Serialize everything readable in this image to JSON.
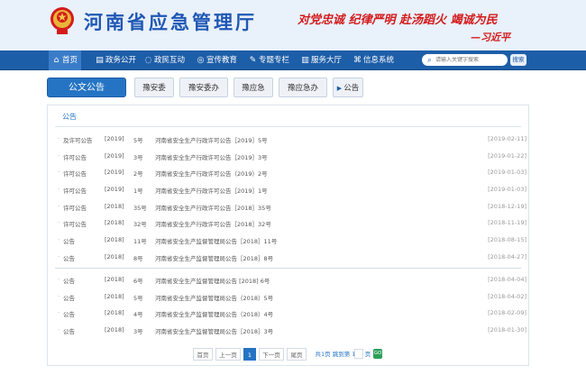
{
  "header": {
    "title": "河南省应急管理厅",
    "slogan": "对党忠诚  纪律严明  赴汤蹈火  竭诚为民",
    "signature": "—习近平"
  },
  "nav": {
    "items": [
      {
        "label": "首页",
        "icon": "home-icon"
      },
      {
        "label": "政务公开",
        "icon": "document-icon"
      },
      {
        "label": "政民互动",
        "icon": "chat-icon"
      },
      {
        "label": "宣传教育",
        "icon": "megaphone-icon"
      },
      {
        "label": "专题专栏",
        "icon": "pencil-icon"
      },
      {
        "label": "服务大厅",
        "icon": "building-icon"
      },
      {
        "label": "信息系统",
        "icon": "grid-icon"
      }
    ],
    "search_placeholder": "请输入关键字搜索",
    "search_button": "搜索"
  },
  "tabs": {
    "main": "公文公告",
    "items": [
      "豫安委",
      "豫安委办",
      "豫应急",
      "豫应急办"
    ],
    "current": "公告"
  },
  "panel": {
    "title": "公告",
    "rows": [
      {
        "category": "及许可公告",
        "year": "[2019]",
        "num": "5号",
        "title": "河南省安全生产行政许可公告［2019］5号",
        "date": "[2019-02-11]"
      },
      {
        "category": "许可公告",
        "year": "[2019]",
        "num": "3号",
        "title": "河南省安全生产行政许可公告［2019］3号",
        "date": "[2019-01-22]"
      },
      {
        "category": "许可公告",
        "year": "[2019]",
        "num": "2号",
        "title": "河南省安全生产行政许可公告（2019）2号",
        "date": "[2019-01-03]"
      },
      {
        "category": "许可公告",
        "year": "[2019]",
        "num": "1号",
        "title": "河南省安全生产行政许可公告［2019］1号",
        "date": "[2019-01-03]"
      },
      {
        "category": "许可公告",
        "year": "[2018]",
        "num": "35号",
        "title": "河南省安全生产行政许可公告［2018］35号",
        "date": "[2018-12-19]"
      },
      {
        "category": "许可公告",
        "year": "[2018]",
        "num": "32号",
        "title": "河南省安全生产行政许可公告［2018］32号",
        "date": "[2018-11-19]"
      },
      {
        "category": "公告",
        "year": "[2018]",
        "num": "11号",
        "title": "河南省安全生产监督管理局公告［2018］11号",
        "date": "[2018-08-15]"
      },
      {
        "category": "公告",
        "year": "[2018]",
        "num": "8号",
        "title": "河南省安全生产监督管理局公告［2018］8号",
        "date": "[2018-04-27]"
      },
      {
        "category": "公告",
        "year": "[2018]",
        "num": "6号",
        "title": "河南省安全生产监督管理局公告 [2018] 6号",
        "date": "[2018-04-04]"
      },
      {
        "category": "公告",
        "year": "[2018]",
        "num": "5号",
        "title": "河南省安全生产监督管理局公告（2018）5号",
        "date": "[2018-04-02]"
      },
      {
        "category": "公告",
        "year": "[2018]",
        "num": "4号",
        "title": "河南省安全生产监督管理局公告（2018）4号",
        "date": "[2018-02-09]"
      },
      {
        "category": "公告",
        "year": "[2018]",
        "num": "3号",
        "title": "河南省安全生产监督管理局公告［2018］3号",
        "date": "[2018-01-30]"
      }
    ]
  },
  "pager": {
    "first": "首页",
    "prev": "上一页",
    "current": "1",
    "next": "下一页",
    "last": "尾页",
    "info": "共1页  跳到第  1",
    "page_unit": "页",
    "go": "GO"
  },
  "colors": {
    "brand": "#1d5ea8",
    "accent": "#2574c4",
    "slogan": "#d41b1b",
    "go_button": "#2e9e5b"
  }
}
